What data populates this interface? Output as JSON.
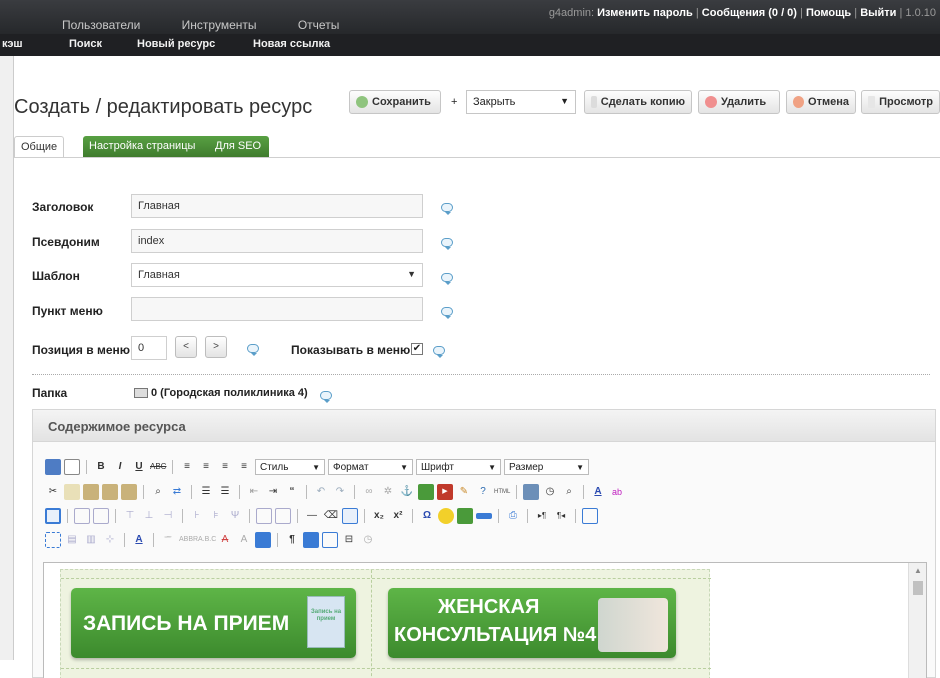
{
  "topbar": {
    "user": "g4admin:",
    "change_password": "Изменить пароль",
    "messages": "Сообщения (0 / 0)",
    "help": "Помощь",
    "logout": "Выйти",
    "version": "| 1.0.10",
    "menu": [
      "Пользователи",
      "Инструменты",
      "Отчеты"
    ]
  },
  "subbar": [
    "кэш",
    "Поиск",
    "Новый ресурс",
    "Новая ссылка"
  ],
  "page": {
    "title": "Создать / редактировать ресурс"
  },
  "actions": {
    "save": "Сохранить",
    "plus": "+",
    "close_select": "Закрыть",
    "duplicate": "Сделать копию",
    "delete": "Удалить",
    "cancel": "Отмена",
    "preview": "Просмотр"
  },
  "tabs": [
    "Общие",
    "Настройка страницы",
    "Для SEO"
  ],
  "form": {
    "title_label": "Заголовок",
    "title_value": "Главная",
    "alias_label": "Псевдоним",
    "alias_value": "index",
    "template_label": "Шаблон",
    "template_value": "Главная",
    "menu_item_label": "Пункт меню",
    "menu_item_value": "",
    "menu_pos_label": "Позиция в меню",
    "menu_pos_value": "0",
    "prev": "<",
    "next": ">",
    "show_in_menu_label": "Показывать в меню",
    "folder_label": "Папка",
    "folder_value": "0 (Городская поликлиника 4)"
  },
  "content": {
    "header": "Содержимое ресурса",
    "style_select": "Стиль",
    "format_select": "Формат",
    "font_select": "Шрифт",
    "size_select": "Размер",
    "banner1": "ЗАПИСЬ НА ПРИЕМ",
    "banner1_badge": "Запись на прием",
    "banner2_line1": "ЖЕНСКАЯ",
    "banner2_line2": "КОНСУЛЬТАЦИЯ №4"
  }
}
